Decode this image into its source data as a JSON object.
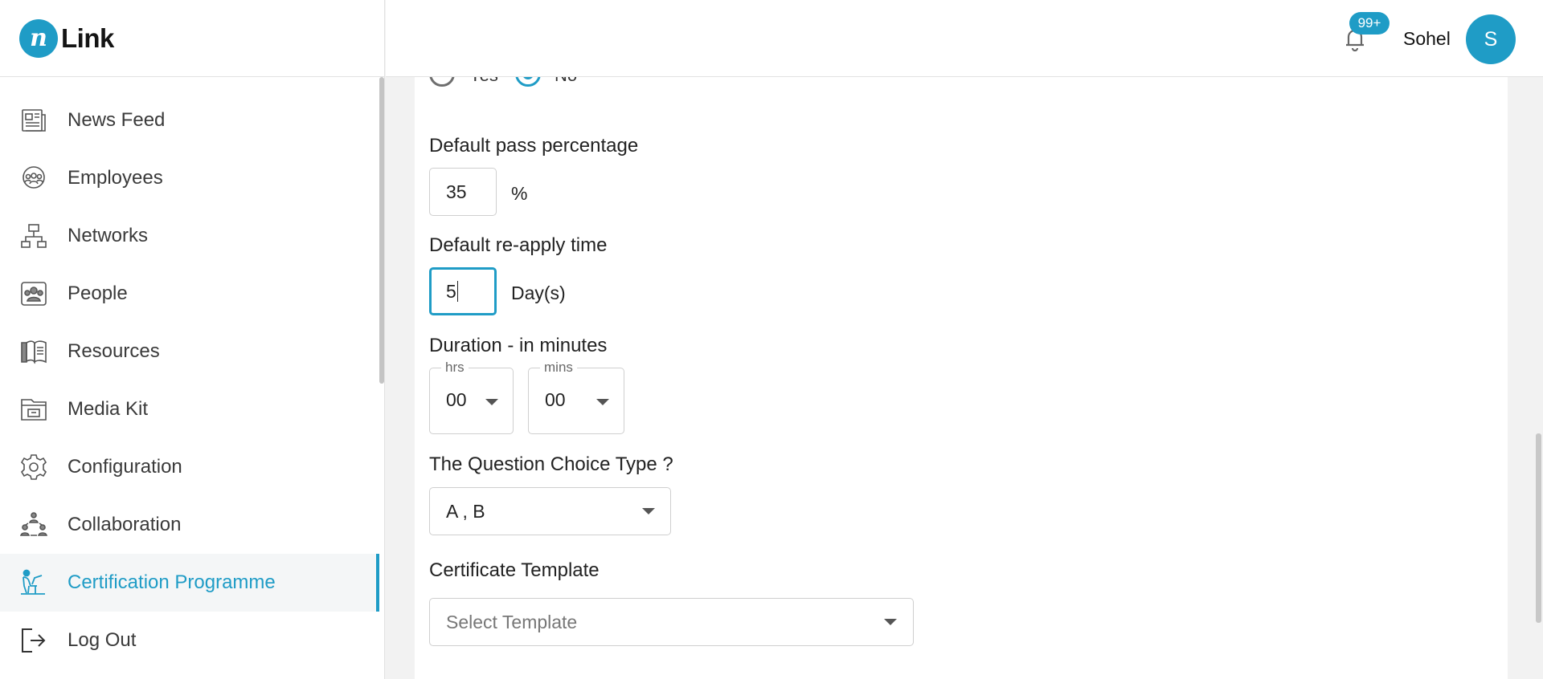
{
  "brand": {
    "mark": "n",
    "word": "Link"
  },
  "sidebar": {
    "items": [
      {
        "label": "News Feed",
        "icon": "news-feed-icon"
      },
      {
        "label": "Employees",
        "icon": "employees-icon"
      },
      {
        "label": "Networks",
        "icon": "networks-icon"
      },
      {
        "label": "People",
        "icon": "people-icon"
      },
      {
        "label": "Resources",
        "icon": "resources-icon"
      },
      {
        "label": "Media Kit",
        "icon": "media-kit-icon"
      },
      {
        "label": "Configuration",
        "icon": "gear-icon"
      },
      {
        "label": "Collaboration",
        "icon": "collaboration-icon"
      },
      {
        "label": "Certification Programme",
        "icon": "certification-icon",
        "active": true
      },
      {
        "label": "Log Out",
        "icon": "logout-icon"
      }
    ]
  },
  "header": {
    "notification_count": "99+",
    "user_name": "Sohel",
    "avatar_initial": "S"
  },
  "form": {
    "radio": {
      "yes_label": "Yes",
      "no_label": "No",
      "selected": "No"
    },
    "pass_percentage": {
      "label": "Default pass percentage",
      "value": "35",
      "suffix": "%"
    },
    "reapply_time": {
      "label": "Default re-apply time",
      "value": "5",
      "suffix": "Day(s)"
    },
    "duration": {
      "label": "Duration - in minutes",
      "hrs_legend": "hrs",
      "hrs_value": "00",
      "mins_legend": "mins",
      "mins_value": "00"
    },
    "choice_type": {
      "label": "The Question Choice Type ?",
      "value": "A , B"
    },
    "certificate_template": {
      "label": "Certificate Template",
      "placeholder": "Select Template"
    }
  },
  "colors": {
    "accent": "#1f9cc6",
    "text": "#222222",
    "border": "#cfcfcf"
  }
}
